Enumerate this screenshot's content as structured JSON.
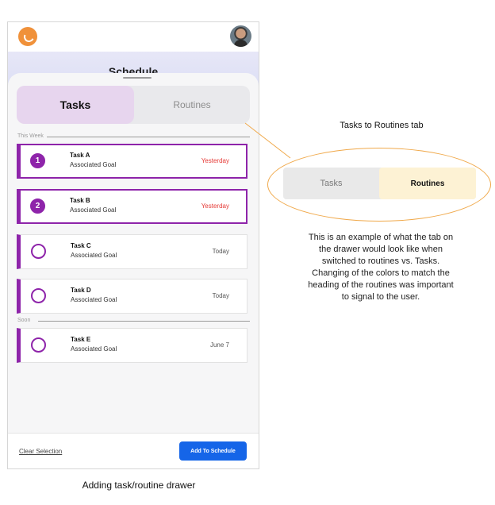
{
  "phone": {
    "background_heading": "Schedule",
    "tabs": [
      {
        "label": "Tasks",
        "active": true
      },
      {
        "label": "Routines",
        "active": false
      }
    ],
    "sections": [
      {
        "label": "This Week"
      },
      {
        "label": "Soon"
      }
    ],
    "tasks": [
      {
        "marker": "1",
        "title": "Task A",
        "goal": "Associated Goal",
        "due": "Yesterday",
        "selected": true
      },
      {
        "marker": "2",
        "title": "Task B",
        "goal": "Associated Goal",
        "due": "Yesterday",
        "selected": true
      },
      {
        "marker": "",
        "title": "Task C",
        "goal": "Associated Goal",
        "due": "Today",
        "selected": false
      },
      {
        "marker": "",
        "title": "Task D",
        "goal": "Associated Goal",
        "due": "Today",
        "selected": false
      },
      {
        "marker": "",
        "title": "Task E",
        "goal": "Associated Goal",
        "due": "June 7",
        "selected": false
      }
    ],
    "footer": {
      "clear_label": "Clear Selection",
      "add_label": "Add To Schedule"
    }
  },
  "caption": "Adding task/routine drawer",
  "annotation": {
    "title": "Tasks to Routines tab",
    "mini_tabs": [
      {
        "label": "Tasks",
        "active": false
      },
      {
        "label": "Routines",
        "active": true
      }
    ],
    "body": "This is an example of what the tab on the drawer would look like when switched to routines vs. Tasks. Changing of the colors to match the heading of the routines was important to signal to the user."
  },
  "colors": {
    "accent_purple": "#8e24aa",
    "active_tab_tasks": "#e7d5ee",
    "active_tab_routines": "#fdf2d4",
    "overdue_red": "#e53935",
    "primary_blue": "#1565e8",
    "annotation_orange": "#f0a94b"
  },
  "icons": [
    "app-logo-icon",
    "avatar",
    "drag-handle-icon"
  ]
}
